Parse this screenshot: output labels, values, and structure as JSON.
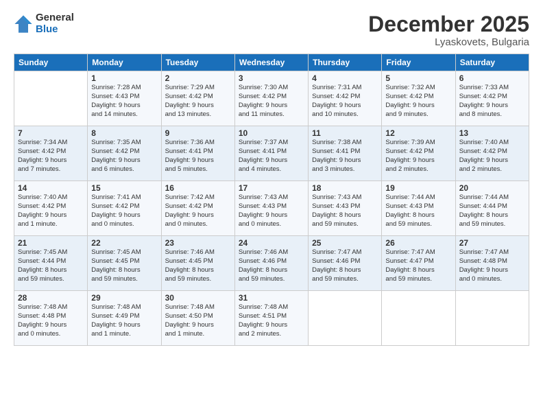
{
  "logo": {
    "general": "General",
    "blue": "Blue"
  },
  "header": {
    "month": "December 2025",
    "location": "Lyaskovets, Bulgaria"
  },
  "weekdays": [
    "Sunday",
    "Monday",
    "Tuesday",
    "Wednesday",
    "Thursday",
    "Friday",
    "Saturday"
  ],
  "weeks": [
    [
      {
        "day": null,
        "info": null
      },
      {
        "day": "1",
        "info": "Sunrise: 7:28 AM\nSunset: 4:43 PM\nDaylight: 9 hours\nand 14 minutes."
      },
      {
        "day": "2",
        "info": "Sunrise: 7:29 AM\nSunset: 4:42 PM\nDaylight: 9 hours\nand 13 minutes."
      },
      {
        "day": "3",
        "info": "Sunrise: 7:30 AM\nSunset: 4:42 PM\nDaylight: 9 hours\nand 11 minutes."
      },
      {
        "day": "4",
        "info": "Sunrise: 7:31 AM\nSunset: 4:42 PM\nDaylight: 9 hours\nand 10 minutes."
      },
      {
        "day": "5",
        "info": "Sunrise: 7:32 AM\nSunset: 4:42 PM\nDaylight: 9 hours\nand 9 minutes."
      },
      {
        "day": "6",
        "info": "Sunrise: 7:33 AM\nSunset: 4:42 PM\nDaylight: 9 hours\nand 8 minutes."
      }
    ],
    [
      {
        "day": "7",
        "info": "Sunrise: 7:34 AM\nSunset: 4:42 PM\nDaylight: 9 hours\nand 7 minutes."
      },
      {
        "day": "8",
        "info": "Sunrise: 7:35 AM\nSunset: 4:42 PM\nDaylight: 9 hours\nand 6 minutes."
      },
      {
        "day": "9",
        "info": "Sunrise: 7:36 AM\nSunset: 4:41 PM\nDaylight: 9 hours\nand 5 minutes."
      },
      {
        "day": "10",
        "info": "Sunrise: 7:37 AM\nSunset: 4:41 PM\nDaylight: 9 hours\nand 4 minutes."
      },
      {
        "day": "11",
        "info": "Sunrise: 7:38 AM\nSunset: 4:41 PM\nDaylight: 9 hours\nand 3 minutes."
      },
      {
        "day": "12",
        "info": "Sunrise: 7:39 AM\nSunset: 4:42 PM\nDaylight: 9 hours\nand 2 minutes."
      },
      {
        "day": "13",
        "info": "Sunrise: 7:40 AM\nSunset: 4:42 PM\nDaylight: 9 hours\nand 2 minutes."
      }
    ],
    [
      {
        "day": "14",
        "info": "Sunrise: 7:40 AM\nSunset: 4:42 PM\nDaylight: 9 hours\nand 1 minute."
      },
      {
        "day": "15",
        "info": "Sunrise: 7:41 AM\nSunset: 4:42 PM\nDaylight: 9 hours\nand 0 minutes."
      },
      {
        "day": "16",
        "info": "Sunrise: 7:42 AM\nSunset: 4:42 PM\nDaylight: 9 hours\nand 0 minutes."
      },
      {
        "day": "17",
        "info": "Sunrise: 7:43 AM\nSunset: 4:43 PM\nDaylight: 9 hours\nand 0 minutes."
      },
      {
        "day": "18",
        "info": "Sunrise: 7:43 AM\nSunset: 4:43 PM\nDaylight: 8 hours\nand 59 minutes."
      },
      {
        "day": "19",
        "info": "Sunrise: 7:44 AM\nSunset: 4:43 PM\nDaylight: 8 hours\nand 59 minutes."
      },
      {
        "day": "20",
        "info": "Sunrise: 7:44 AM\nSunset: 4:44 PM\nDaylight: 8 hours\nand 59 minutes."
      }
    ],
    [
      {
        "day": "21",
        "info": "Sunrise: 7:45 AM\nSunset: 4:44 PM\nDaylight: 8 hours\nand 59 minutes."
      },
      {
        "day": "22",
        "info": "Sunrise: 7:45 AM\nSunset: 4:45 PM\nDaylight: 8 hours\nand 59 minutes."
      },
      {
        "day": "23",
        "info": "Sunrise: 7:46 AM\nSunset: 4:45 PM\nDaylight: 8 hours\nand 59 minutes."
      },
      {
        "day": "24",
        "info": "Sunrise: 7:46 AM\nSunset: 4:46 PM\nDaylight: 8 hours\nand 59 minutes."
      },
      {
        "day": "25",
        "info": "Sunrise: 7:47 AM\nSunset: 4:46 PM\nDaylight: 8 hours\nand 59 minutes."
      },
      {
        "day": "26",
        "info": "Sunrise: 7:47 AM\nSunset: 4:47 PM\nDaylight: 8 hours\nand 59 minutes."
      },
      {
        "day": "27",
        "info": "Sunrise: 7:47 AM\nSunset: 4:48 PM\nDaylight: 9 hours\nand 0 minutes."
      }
    ],
    [
      {
        "day": "28",
        "info": "Sunrise: 7:48 AM\nSunset: 4:48 PM\nDaylight: 9 hours\nand 0 minutes."
      },
      {
        "day": "29",
        "info": "Sunrise: 7:48 AM\nSunset: 4:49 PM\nDaylight: 9 hours\nand 1 minute."
      },
      {
        "day": "30",
        "info": "Sunrise: 7:48 AM\nSunset: 4:50 PM\nDaylight: 9 hours\nand 1 minute."
      },
      {
        "day": "31",
        "info": "Sunrise: 7:48 AM\nSunset: 4:51 PM\nDaylight: 9 hours\nand 2 minutes."
      },
      {
        "day": null,
        "info": null
      },
      {
        "day": null,
        "info": null
      },
      {
        "day": null,
        "info": null
      }
    ]
  ]
}
